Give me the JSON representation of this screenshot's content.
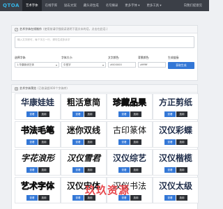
{
  "logo": "QTOA",
  "nav": {
    "items": [
      "艺术字体",
      "在线字库",
      "励志文案",
      "藏头诗生成",
      "名句摘录",
      "更多字体 ▾",
      "更多工具 ▾"
    ],
    "right": "向我们提意见"
  },
  "generator": {
    "title": "艺术字体在线制作",
    "note": "(使用前请仔细阅读说明下面文本的话，点击在此话.)",
    "textarea_placeholder": "输入文字即可，每个字占一行，请勿生成多余字",
    "font_label": "选择字体:",
    "font_value": "1.华康新综艺体",
    "size_label": "字体大小:",
    "size_value": "中型字",
    "color_label": "文字颜色:",
    "color_value": "#000000",
    "bg_label": "背景颜色:",
    "bg_value": "#ffffff",
    "btn_label": "生成链接:",
    "btn_text": "获取生成"
  },
  "presets": {
    "title": "艺术字体预览",
    "note": "(已收录超400个字体库)",
    "view_label": "查看",
    "select_label": "选用",
    "cards": [
      {
        "text": "华康娃娃",
        "style": "navy"
      },
      {
        "text": "粗活意简",
        "style": ""
      },
      {
        "text": "珍藏品果",
        "style": "outline"
      },
      {
        "text": "方正剪纸",
        "style": "navy"
      },
      {
        "text": "书法毛笔",
        "style": "outline"
      },
      {
        "text": "迷你双线",
        "style": ""
      },
      {
        "text": "古印篆体",
        "style": "thin"
      },
      {
        "text": "汉仪彩蝶",
        "style": "navy"
      },
      {
        "text": "字花浪形",
        "style": "italic"
      },
      {
        "text": "汉仪雪君",
        "style": "italic"
      },
      {
        "text": "汉仪综艺",
        "style": "navy"
      },
      {
        "text": "汉仪楷榄",
        "style": "navy"
      },
      {
        "text": "艺术字体",
        "style": "outline"
      },
      {
        "text": "汉仪宋体",
        "style": ""
      },
      {
        "text": "汉仪书法",
        "style": "thin"
      },
      {
        "text": "汉仪太级",
        "style": "navy"
      }
    ]
  },
  "watermark": "玖玖资源",
  "colors": {
    "nav_bg": "#3b3f47",
    "primary": "#3377d6",
    "dark_btn": "#2b2e33",
    "logo": "#35b4e6",
    "watermark": "#e7454a"
  }
}
